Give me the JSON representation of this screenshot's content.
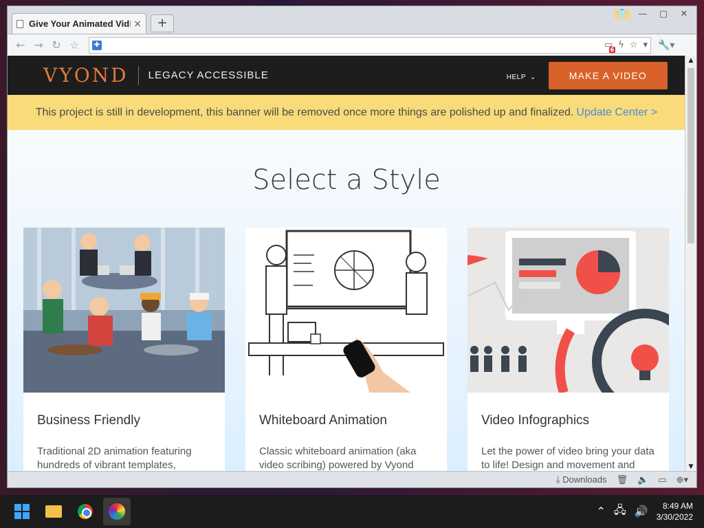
{
  "browser": {
    "tab_title": "Give Your Animated Vid\u0000",
    "tab_close": "×",
    "new_tab": "+",
    "downloads_label": "Downloads"
  },
  "site": {
    "logo": "VYOND",
    "logo_sub": "LEGACY ACCESSIBLE",
    "help_label": "HELP",
    "cta_label": "MAKE A VIDEO"
  },
  "banner": {
    "text": "This project is still in development, this banner will be removed once more things are polished up and finalized.",
    "link": "Update Center >"
  },
  "heading": "Select a Style",
  "cards": [
    {
      "title": "Business Friendly",
      "desc": "Traditional 2D animation featuring hundreds of vibrant templates,"
    },
    {
      "title": "Whiteboard Animation",
      "desc": "Classic whiteboard animation (aka video scribing) powered by Vyond"
    },
    {
      "title": "Video Infographics",
      "desc": "Let the power of video bring your data to life! Design and movement and"
    }
  ],
  "taskbar": {
    "time": "8:49 AM",
    "date": "3/30/2022"
  },
  "colors": {
    "accent": "#d8622a",
    "banner": "#f9db7a",
    "link": "#4a8ad6"
  }
}
